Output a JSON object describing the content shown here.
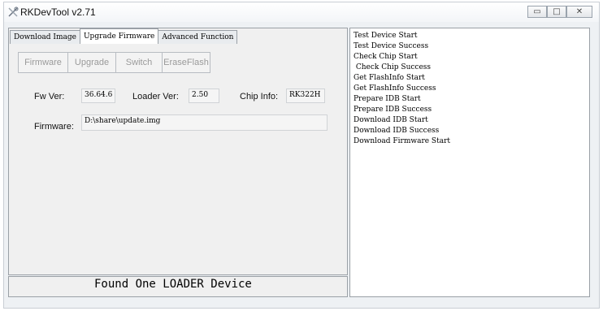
{
  "window": {
    "title": "RKDevTool v2.71",
    "controls": {
      "minimize": "▭",
      "maximize": "□",
      "close": "✕"
    }
  },
  "tabs": [
    {
      "label": "Download Image",
      "active": false
    },
    {
      "label": "Upgrade Firmware",
      "active": true
    },
    {
      "label": "Advanced Function",
      "active": false
    }
  ],
  "toolbar": {
    "firmware": "Firmware",
    "upgrade": "Upgrade",
    "switch": "Switch",
    "eraseflash": "EraseFlash"
  },
  "info": {
    "fw_label": "Fw Ver:",
    "fw_value": "36.64.6",
    "loader_label": "Loader Ver:",
    "loader_value": "2.50",
    "chip_label": "Chip Info:",
    "chip_value": "RK322H",
    "firmware_label": "Firmware:",
    "firmware_path": "D:\\share\\update.img"
  },
  "status": "Found One LOADER Device",
  "log": [
    "Test Device Start",
    "Test Device Success",
    "Check Chip Start",
    " Check Chip Success",
    "Get FlashInfo Start",
    "Get FlashInfo Success",
    "Prepare IDB Start",
    "Prepare IDB Success",
    "Download IDB Start",
    "Download IDB Success",
    "Download Firmware Start"
  ]
}
